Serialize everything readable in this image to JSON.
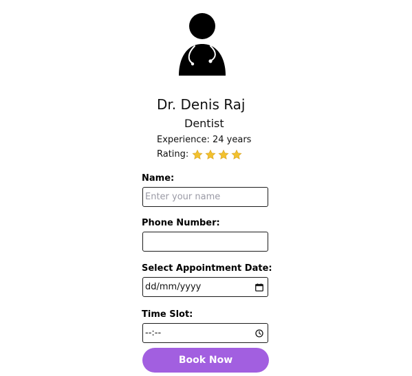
{
  "doctor": {
    "avatar_icon": "doctor-with-stethoscope-icon",
    "name": "Dr. Denis Raj",
    "specialty": "Dentist",
    "experience": "Experience: 24 years",
    "rating_label": "Rating:",
    "rating_stars": 4,
    "star_icon": "star-icon",
    "star_color": "#f2c12e"
  },
  "form": {
    "name": {
      "label": "Name:",
      "placeholder": "Enter your name",
      "value": ""
    },
    "phone": {
      "label": "Phone Number:",
      "value": ""
    },
    "date": {
      "label": "Select Appointment Date:",
      "value": "dd/mm/yyyy",
      "icon": "calendar-icon"
    },
    "time": {
      "label": "Time Slot:",
      "value": "--:--",
      "icon": "clock-icon"
    },
    "submit_label": "Book Now",
    "accent_color": "#a25fe0"
  }
}
